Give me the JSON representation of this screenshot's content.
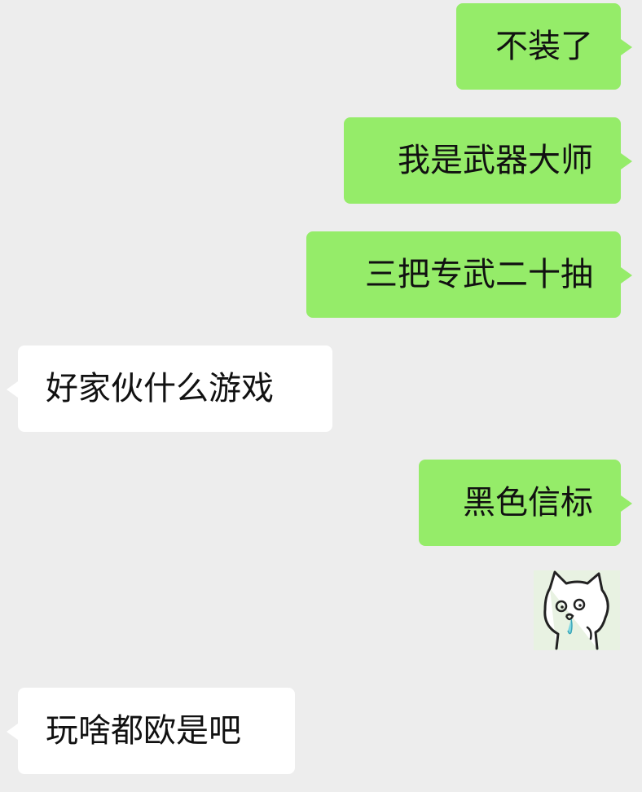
{
  "messages": [
    {
      "side": "sent",
      "text": "不装了"
    },
    {
      "side": "sent",
      "text": "我是武器大师"
    },
    {
      "side": "sent",
      "text": "三把专武二十抽"
    },
    {
      "side": "received",
      "text": "好家伙什么游戏"
    },
    {
      "side": "sent",
      "text": "黑色信标"
    },
    {
      "side": "sent",
      "type": "sticker",
      "sticker": "cat-drooling-sticker"
    },
    {
      "side": "received",
      "text": "玩啥都欧是吧"
    }
  ],
  "colors": {
    "background": "#ededed",
    "sent_bubble": "#95ec69",
    "received_bubble": "#ffffff",
    "text": "#111111"
  }
}
